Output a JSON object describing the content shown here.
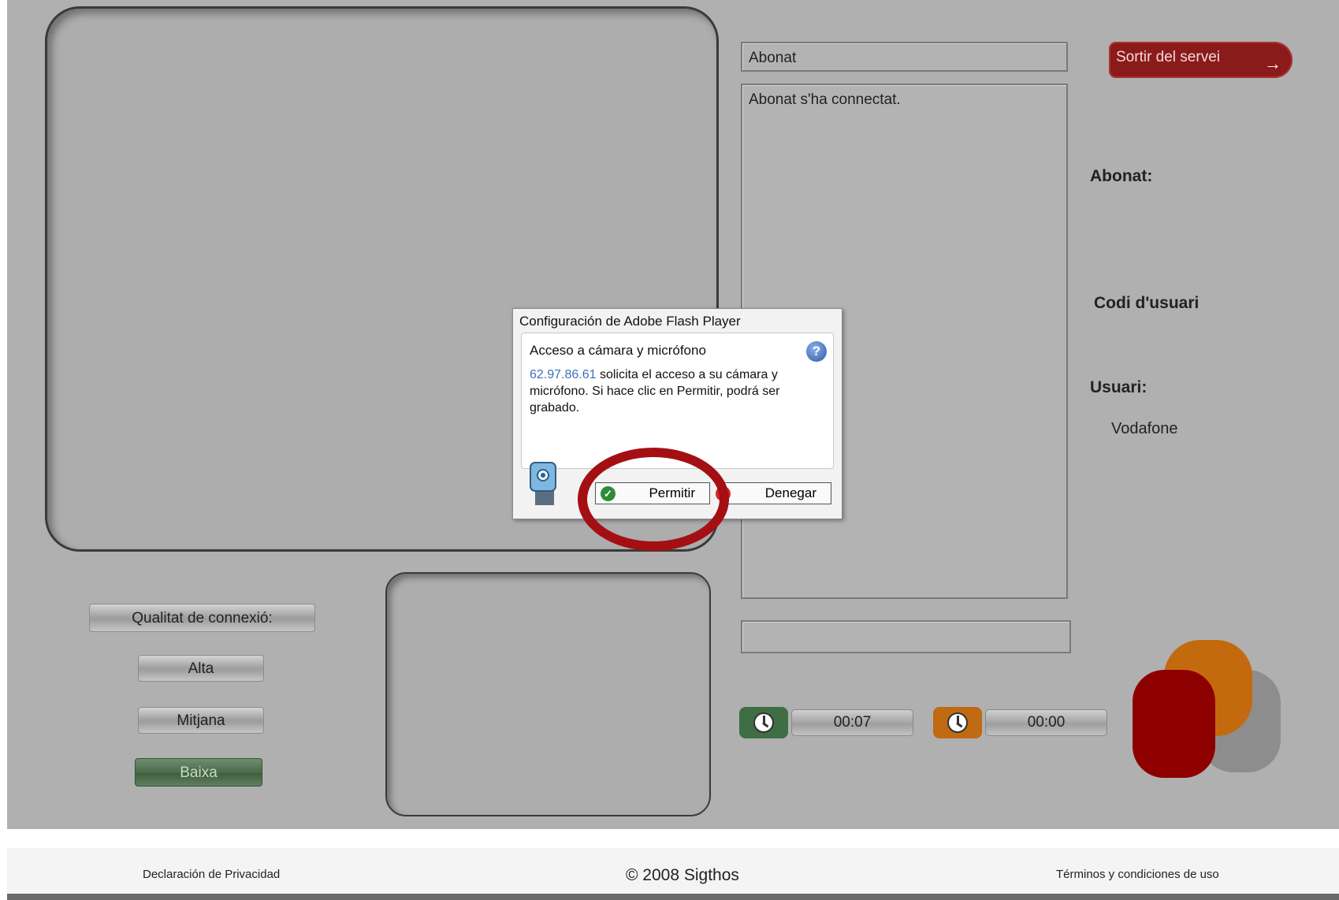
{
  "session": {
    "remote_name": "Abonat",
    "chat_messages": [
      "Abonat s'ha connectat."
    ],
    "exit_label": "Sortir del servei",
    "exit_arrow": "→"
  },
  "side_info": {
    "abonat_label": "Abonat:",
    "user_code_label": "Codi d'usuari",
    "user_label": "Usuari:",
    "user_value": "Vodafone"
  },
  "quality": {
    "header": "Qualitat de connexió:",
    "options": [
      "Alta",
      "Mitjana",
      "Baixa"
    ],
    "selected": "Baixa",
    "active_color": "#4a6c4b"
  },
  "timers": [
    {
      "value": "00:07",
      "color": "#3f6e45"
    },
    {
      "value": "00:00",
      "color": "#c06a14"
    }
  ],
  "flash_dialog": {
    "title": "Configuración de Adobe Flash Player",
    "heading": "Acceso a cámara y micrófono",
    "ip": "62.97.86.61",
    "message": " solicita el acceso a su cámara y micrófono. Si hace clic en Permitir, podrá ser grabado.",
    "help_icon": "?",
    "allow_label": "Permitir",
    "deny_label": "Denegar"
  },
  "footer": {
    "privacy": "Declaración de Privacidad",
    "copyright": "© 2008 Sigthos",
    "terms": "Términos y condiciones de uso"
  },
  "colors": {
    "background": "#b0b0b0",
    "exit_button": "#8b1a1a",
    "highlight_ring": "#a40f14",
    "logo_red": "#8e0000",
    "logo_orange": "#c36a0e",
    "logo_gray": "#8d8d8d"
  }
}
